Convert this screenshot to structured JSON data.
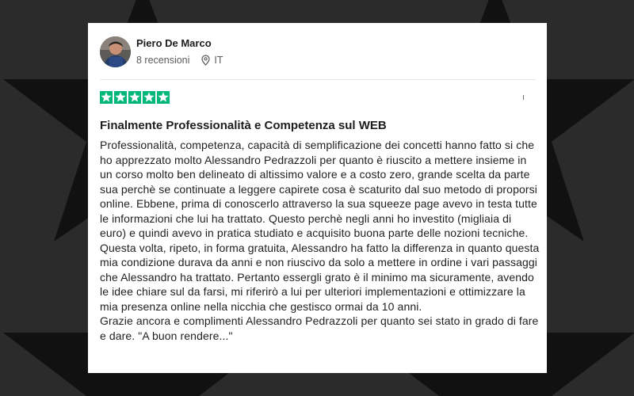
{
  "reviewer": {
    "name": "Piero De Marco",
    "reviews_count": "8 recensioni",
    "country": "IT",
    "avatar_icon": "person-avatar",
    "location_icon": "map-pin-icon"
  },
  "rating": {
    "stars": 5,
    "max": 5,
    "star_color": "#00b67a",
    "extra_marker": "ı"
  },
  "review": {
    "title": "Finalmente Professionalità e Competenza sul WEB",
    "paragraphs": [
      "Professionalità, competenza, capacità di semplificazione dei concetti hanno fatto si che ho apprezzato molto Alessandro Pedrazzoli per quanto è riuscito a mettere insieme in un corso molto ben delineato di altissimo valore e a costo zero, grande scelta da parte sua perchè se continuate a leggere capirete cosa è scaturito dal suo metodo di proporsi online. Ebbene, prima di conoscerlo attraverso la sua squeeze page avevo in testa tutte le informazioni che lui ha trattato. Questo perchè negli anni ho investito (migliaia di euro) e quindi avevo in pratica studiato e acquisito buona parte delle nozioni tecniche. Questa volta, ripeto, in forma gratuita, Alessandro ha fatto la differenza in quanto questa mia condizione durava da anni e non riuscivo da solo a mettere in ordine i vari passaggi che Alessandro ha trattato. Pertanto essergli grato è il minimo ma sicuramente, avendo le idee chiare sul da farsi, mi riferirò a lui per ulteriori implementazioni e ottimizzare la mia presenza online nella nicchia che gestisco ormai da 10 anni.",
      "Grazie ancora e complimenti Alessandro Pedrazzoli per quanto sei stato in grado di fare e dare. \"A buon rendere...\""
    ]
  },
  "background": {
    "color": "#2b2b2b",
    "star_color": "#111111"
  }
}
